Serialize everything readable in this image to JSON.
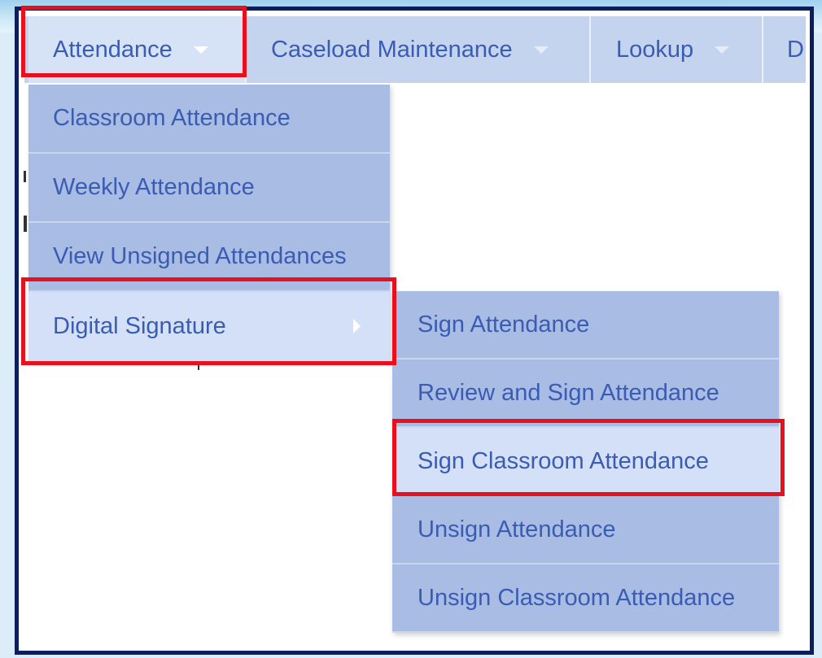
{
  "menubar": {
    "items": [
      {
        "label": "Attendance",
        "has_dropdown": true,
        "open": true
      },
      {
        "label": "Caseload Maintenance",
        "has_dropdown": true
      },
      {
        "label": "Lookup",
        "has_dropdown": true
      },
      {
        "label": "D",
        "has_dropdown": false
      }
    ]
  },
  "attendance_menu": {
    "items": [
      {
        "label": "Classroom Attendance"
      },
      {
        "label": "Weekly Attendance"
      },
      {
        "label": "View Unsigned Attendances"
      },
      {
        "label": "Digital Signature",
        "has_submenu": true,
        "active": true
      }
    ]
  },
  "digital_signature_menu": {
    "items": [
      {
        "label": "Sign Attendance"
      },
      {
        "label": "Review and Sign Attendance"
      },
      {
        "label": "Sign Classroom Attendance",
        "highlighted": true
      },
      {
        "label": "Unsign Attendance"
      },
      {
        "label": "Unsign Classroom Attendance"
      }
    ]
  },
  "colors": {
    "menu_bg": "#c4d4ef",
    "item_bg": "#a9bce4",
    "item_active_bg": "#d4e0f7",
    "text": "#3a5cb2",
    "highlight_border": "#e8101c",
    "frame_border": "#0c1f5c"
  }
}
